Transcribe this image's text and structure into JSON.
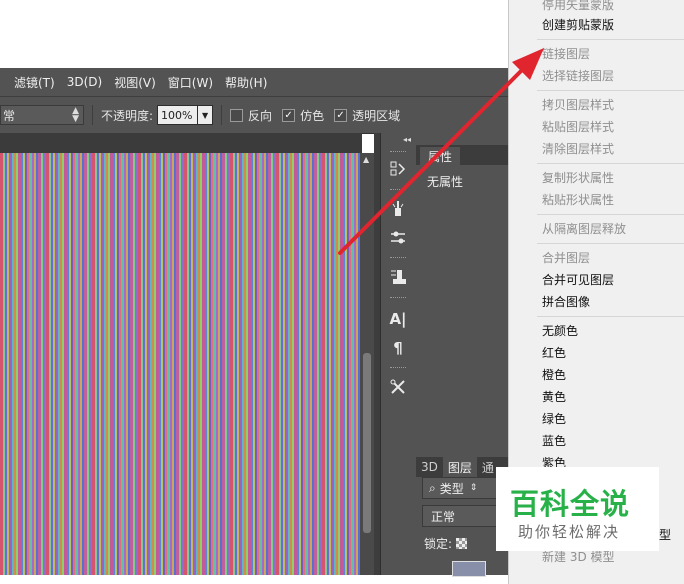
{
  "menubar": {
    "items": [
      "滤镜(T)",
      "3D(D)",
      "视图(V)",
      "窗口(W)",
      "帮助(H)"
    ]
  },
  "options_bar": {
    "mode_value": "常",
    "opacity_label": "不透明度:",
    "opacity_value": "100%",
    "checkbox_reverse": {
      "label": "反向",
      "checked": false
    },
    "checkbox_dither": {
      "label": "仿色",
      "checked": true
    },
    "checkbox_transparency": {
      "label": "透明区域",
      "checked": true
    }
  },
  "properties_panel": {
    "tab_label": "属性",
    "no_properties": "无属性"
  },
  "layers_panel": {
    "tabs": [
      "3D",
      "图层",
      "通"
    ],
    "kind_filter": "类型",
    "blend_mode": "正常",
    "lock_label": "锁定:"
  },
  "context_menu": {
    "items": [
      {
        "label": "停用矢量蒙版",
        "enabled": false
      },
      {
        "label": "创建剪贴蒙版",
        "enabled": true
      },
      {
        "label": "链接图层",
        "enabled": false
      },
      {
        "label": "选择链接图层",
        "enabled": false
      },
      {
        "label": "拷贝图层样式",
        "enabled": false
      },
      {
        "label": "粘贴图层样式",
        "enabled": false
      },
      {
        "label": "清除图层样式",
        "enabled": false
      },
      {
        "label": "复制形状属性",
        "enabled": false
      },
      {
        "label": "粘贴形状属性",
        "enabled": false
      },
      {
        "label": "从隔离图层释放",
        "enabled": false
      },
      {
        "label": "合并图层",
        "enabled": false
      },
      {
        "label": "合并可见图层",
        "enabled": true
      },
      {
        "label": "拼合图像",
        "enabled": true
      },
      {
        "label": "无颜色",
        "enabled": true
      },
      {
        "label": "红色",
        "enabled": true
      },
      {
        "label": "橙色",
        "enabled": true
      },
      {
        "label": "黄色",
        "enabled": true
      },
      {
        "label": "绿色",
        "enabled": true
      },
      {
        "label": "蓝色",
        "enabled": true
      },
      {
        "label": "紫色",
        "enabled": true
      },
      {
        "label": "型",
        "enabled": true
      },
      {
        "label": "新建 3D 模型",
        "enabled": false
      }
    ]
  },
  "watermark": {
    "title": "百科全说",
    "subtitle": "助你轻松解决"
  },
  "colors": {
    "arrow": "#e0252f",
    "watermark_green": "#27b148",
    "panel_bg": "#535353"
  }
}
